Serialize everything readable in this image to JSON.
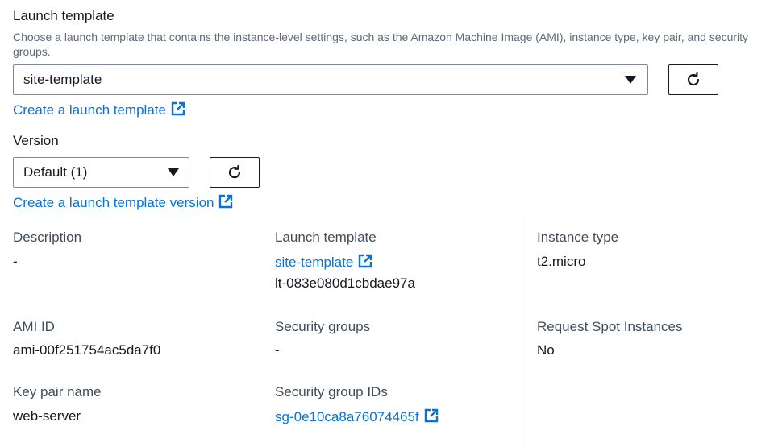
{
  "launch_template": {
    "label": "Launch template",
    "description": "Choose a launch template that contains the instance-level settings, such as the Amazon Machine Image (AMI), instance type, key pair, and security groups.",
    "selected": "site-template",
    "create_link": "Create a launch template"
  },
  "version": {
    "label": "Version",
    "selected": "Default (1)",
    "create_link": "Create a launch template version"
  },
  "details": {
    "description": {
      "label": "Description",
      "value": "-"
    },
    "launch_template": {
      "label": "Launch template",
      "link": "site-template",
      "id": "lt-083e080d1cbdae97a"
    },
    "instance_type": {
      "label": "Instance type",
      "value": "t2.micro"
    },
    "ami_id": {
      "label": "AMI ID",
      "value": "ami-00f251754ac5da7f0"
    },
    "security_groups": {
      "label": "Security groups",
      "value": "-"
    },
    "request_spot": {
      "label": "Request Spot Instances",
      "value": "No"
    },
    "key_pair": {
      "label": "Key pair name",
      "value": "web-server"
    },
    "security_group_ids": {
      "label": "Security group IDs",
      "link": "sg-0e10ca8a76074465f"
    }
  },
  "icons": {
    "refresh": "refresh-icon",
    "external": "external-link-icon",
    "caret": "caret-down-icon"
  },
  "colors": {
    "link": "#0972d3",
    "text": "#16191f",
    "muted": "#5f6b7a",
    "divider": "#e9ebed"
  }
}
